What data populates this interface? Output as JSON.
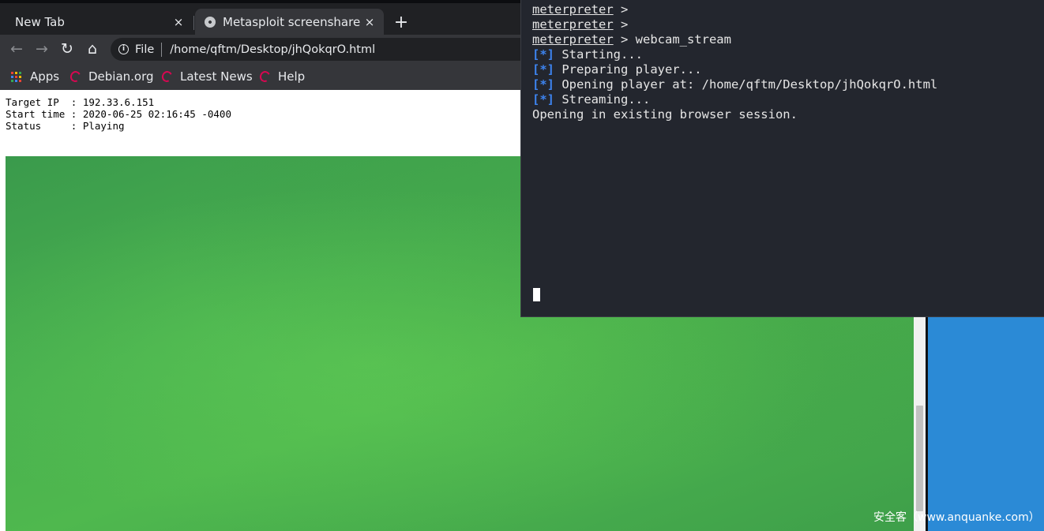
{
  "browser": {
    "tabs": [
      {
        "title": "New Tab",
        "close": "×"
      },
      {
        "title": "Metasploit screenshare - Target",
        "close": "×"
      }
    ],
    "new_tab": "+",
    "omnibox": {
      "scheme_label": "File",
      "url": "/home/qftm/Desktop/jhQokqrO.html"
    },
    "bookmarks": [
      {
        "label": "Apps",
        "icon": "apps-grid-icon"
      },
      {
        "label": "Debian.org",
        "icon": "debian-swirl-icon"
      },
      {
        "label": "Latest News",
        "icon": "debian-swirl-icon"
      },
      {
        "label": "Help",
        "icon": "debian-swirl-icon"
      }
    ],
    "nav_icons": {
      "back": "←",
      "forward": "→",
      "reload": "↻",
      "home": "⌂",
      "info": "i"
    }
  },
  "page": {
    "info_lines": [
      "Target IP  : 192.33.6.151",
      "Start time : 2020-06-25 02:16:45 -0400",
      "Status     : Playing"
    ]
  },
  "terminal": {
    "prompt": "meterpreter",
    "prompt_suffix": " >",
    "command": " webcam_stream",
    "status_tag": "[*]",
    "status_lines": [
      " Starting...",
      " Preparing player...",
      " Opening player at: /home/qftm/Desktop/jhQokqrO.html",
      " Streaming..."
    ],
    "final_line": "Opening in existing browser session."
  },
  "watermark": "安全客（www.anquanke.com）",
  "colors": {
    "browser_bg": "#202124",
    "toolbar_bg": "#35363a",
    "terminal_bg": "#23262e",
    "terminal_tag": "#3d84f0",
    "debian_red": "#d70751",
    "video_green": "#49b14f",
    "desktop_blue": "#2b8ad6"
  }
}
